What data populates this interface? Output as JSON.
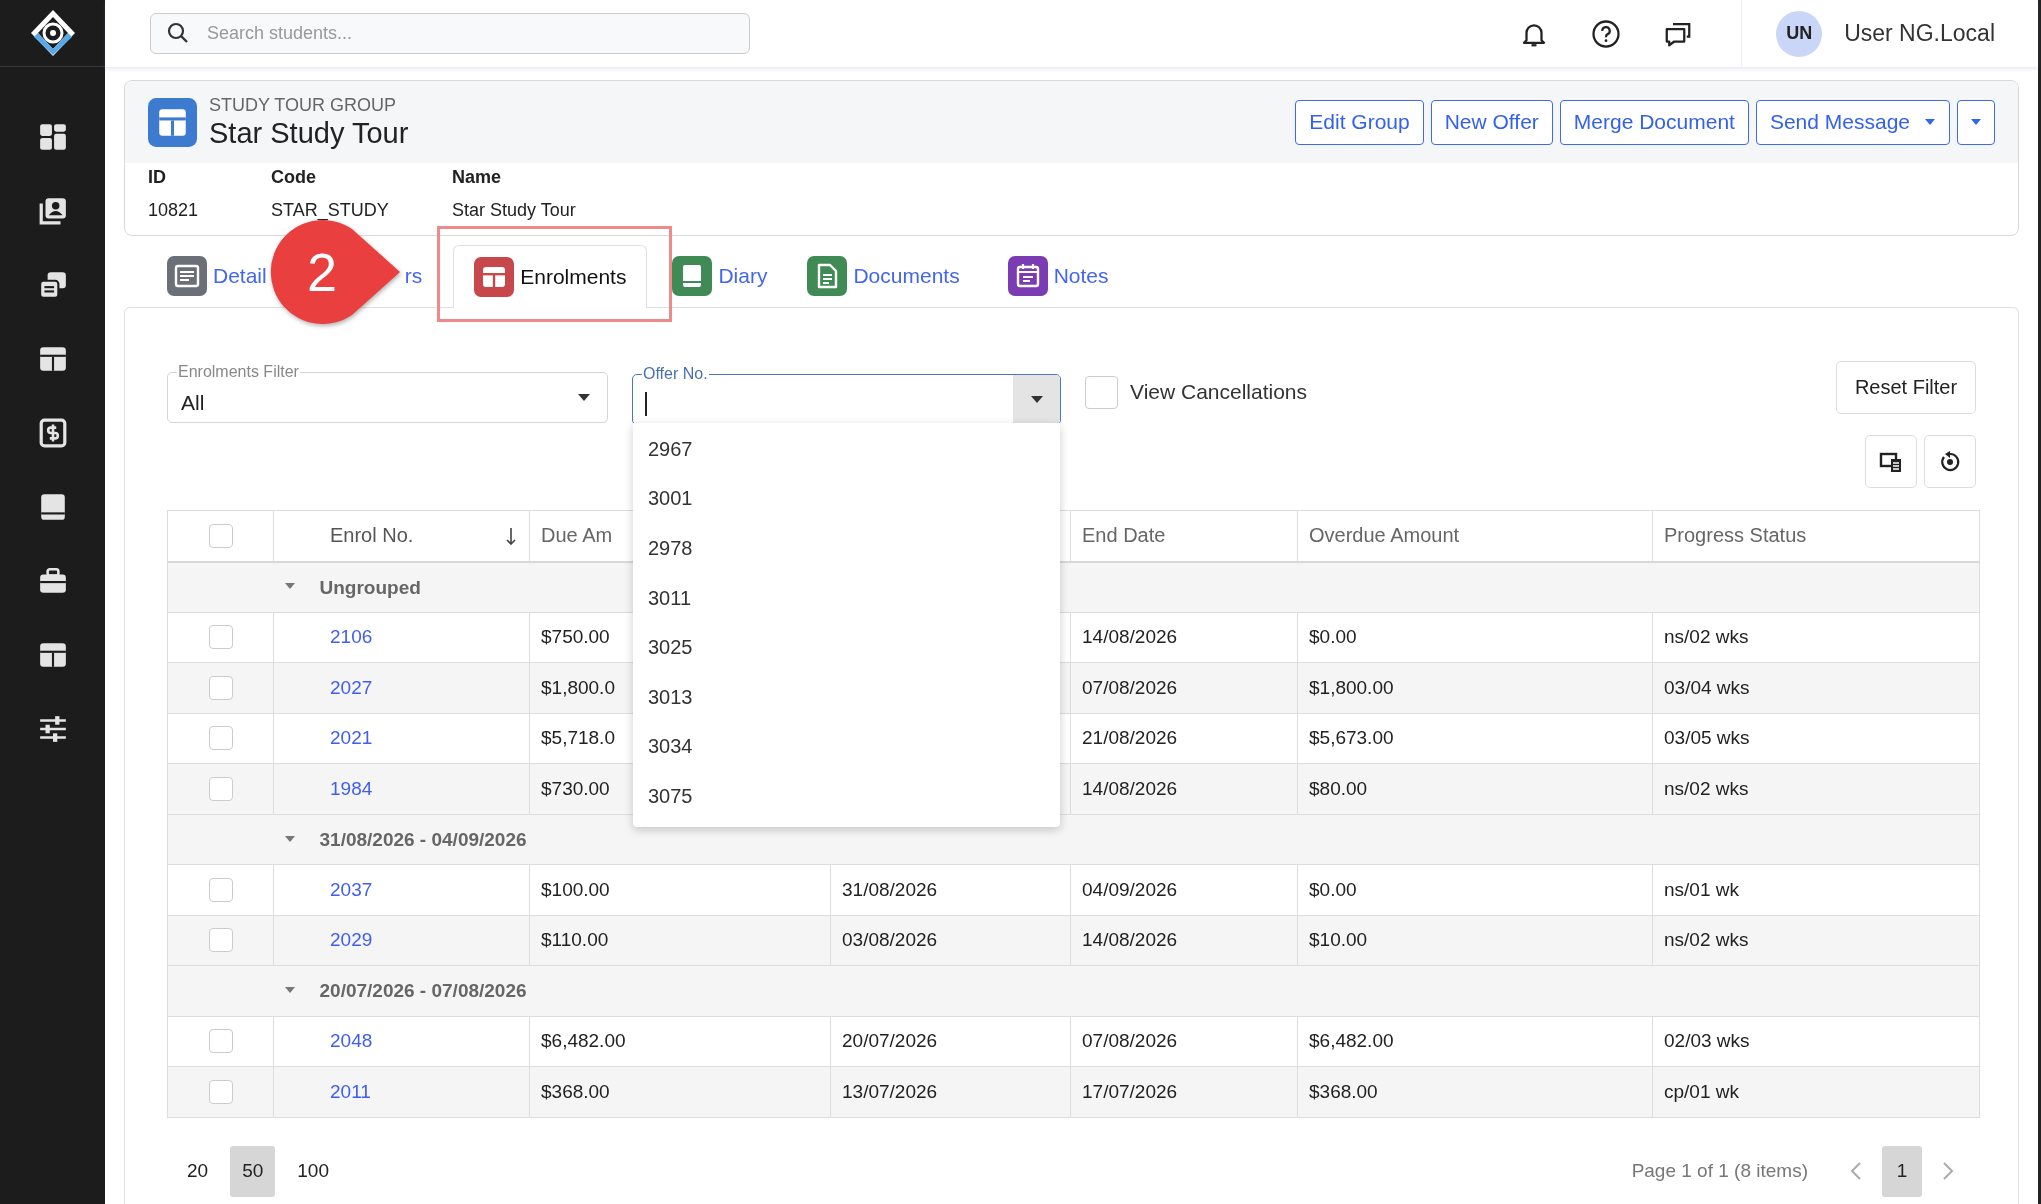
{
  "app": {
    "search": {
      "placeholder": "Search students..."
    },
    "user": {
      "initials": "UN",
      "name": "User NG.Local"
    }
  },
  "record": {
    "type_label": "STUDY TOUR GROUP",
    "title": "Star Study Tour",
    "actions": [
      {
        "kind": "button",
        "label": "Edit Group"
      },
      {
        "kind": "button",
        "label": "New Offer"
      },
      {
        "kind": "button",
        "label": "Merge Document"
      },
      {
        "kind": "split",
        "label": "Send Message"
      },
      {
        "kind": "menu"
      }
    ],
    "fields": [
      {
        "label": "ID",
        "value": "10821"
      },
      {
        "label": "Code",
        "value": "STAR_STUDY"
      },
      {
        "label": "Name",
        "value": "Star Study Tour"
      }
    ]
  },
  "tabs": [
    {
      "kind": "details",
      "label": "Detail",
      "color": "#6b7078",
      "selected": false
    },
    {
      "kind": "covered",
      "label": "rs",
      "selected": false
    },
    {
      "kind": "enrolments",
      "label": "Enrolments",
      "color": "#c8474a",
      "selected": true
    },
    {
      "kind": "diary",
      "label": "Diary",
      "color": "#3f8a55",
      "selected": false
    },
    {
      "kind": "documents",
      "label": "Documents",
      "color": "#3f8a55",
      "selected": false
    },
    {
      "kind": "notes",
      "label": "Notes",
      "color": "#7a3bb3",
      "selected": false
    }
  ],
  "annotation": {
    "number": "2"
  },
  "filters": {
    "enrolments_filter": {
      "label": "Enrolments Filter",
      "value": "All"
    },
    "offer_no": {
      "label": "Offer No.",
      "focused": true,
      "expanded": true,
      "options": [
        "2967",
        "3001",
        "2978",
        "3011",
        "3025",
        "3013",
        "3034",
        "3075"
      ]
    },
    "view_cancellations": {
      "label": "View Cancellations",
      "checked": false
    },
    "reset_button": "Reset Filter"
  },
  "table": {
    "select_all_checked": false,
    "columns": [
      {
        "label": "Enrol No.",
        "sorted": true
      },
      {
        "label": "Due Am"
      },
      {},
      {
        "label": "End Date"
      },
      {
        "label": "Overdue Amount"
      },
      {
        "label": "Progress Status"
      }
    ],
    "groups": [
      {
        "label": "Ungrouped",
        "expanded": true,
        "rows": [
          {
            "checked": false,
            "enrol_no": "2106",
            "column_3": "$750.00",
            "end_date": "14/08/2026",
            "overdue_amount": "$0.00",
            "progress_status": "ns/02 wks"
          },
          {
            "checked": false,
            "enrol_no": "2027",
            "column_3": "$1,800.0",
            "end_date": "07/08/2026",
            "overdue_amount": "$1,800.00",
            "progress_status": "03/04 wks"
          },
          {
            "checked": false,
            "enrol_no": "2021",
            "column_3": "$5,718.0",
            "end_date": "21/08/2026",
            "overdue_amount": "$5,673.00",
            "progress_status": "03/05 wks"
          },
          {
            "checked": false,
            "enrol_no": "1984",
            "column_3": "$730.00",
            "end_date": "14/08/2026",
            "overdue_amount": "$80.00",
            "progress_status": "ns/02 wks"
          }
        ]
      },
      {
        "label": "31/08/2026 - 04/09/2026",
        "expanded": true,
        "rows": [
          {
            "checked": false,
            "enrol_no": "2037",
            "column_3": "$100.00",
            "column_4": "31/08/2026",
            "end_date": "04/09/2026",
            "overdue_amount": "$0.00",
            "progress_status": "ns/01 wk"
          },
          {
            "checked": false,
            "enrol_no": "2029",
            "column_3": "$110.00",
            "column_4": "03/08/2026",
            "end_date": "14/08/2026",
            "overdue_amount": "$10.00",
            "progress_status": "ns/02 wks"
          }
        ]
      },
      {
        "label": "20/07/2026 - 07/08/2026",
        "expanded": true,
        "rows": [
          {
            "checked": false,
            "enrol_no": "2048",
            "column_3": "$6,482.00",
            "column_4": "20/07/2026",
            "end_date": "07/08/2026",
            "overdue_amount": "$6,482.00",
            "progress_status": "02/03 wks"
          },
          {
            "checked": false,
            "enrol_no": "2011",
            "column_3": "$368.00",
            "column_4": "13/07/2026",
            "end_date": "17/07/2026",
            "overdue_amount": "$368.00",
            "progress_status": "cp/01 wk"
          }
        ]
      }
    ]
  },
  "pagination": {
    "page_sizes": [
      {
        "label": "20",
        "selected": false
      },
      {
        "label": "50",
        "selected": true
      },
      {
        "label": "100",
        "selected": false
      }
    ],
    "summary": "Page 1 of 1 (8 items)",
    "pages": [
      {
        "label": "1",
        "selected": true
      }
    ]
  }
}
